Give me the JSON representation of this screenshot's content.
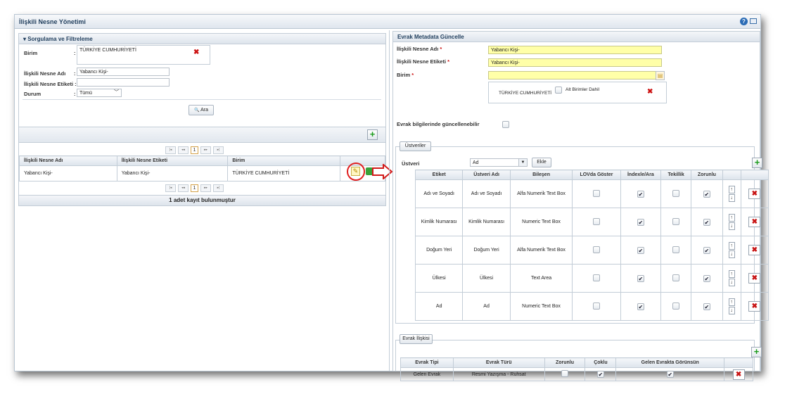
{
  "window": {
    "title": "İlişkili Nesne Yönetimi"
  },
  "filter": {
    "header": "Sorgulama ve Filtreleme",
    "birim_label": "Birim",
    "birim_value": "TÜRKİYE CUMHURİYETİ",
    "nesne_adi_label": "İlişkili Nesne Adı",
    "nesne_adi_value": "Yabancı Kişi-",
    "nesne_etiketi_label": "İlişkili Nesne Etiketi :",
    "durum_label": "Durum",
    "durum_value": "Tümü",
    "colon": ":",
    "search_button": "Ara"
  },
  "results": {
    "page": "1",
    "columns": [
      "İlişkili Nesne Adı",
      "İlişkili Nesne Etiketi",
      "Birim"
    ],
    "rows": [
      [
        "Yabancı Kişi-",
        "Yabancı Kişi-",
        "TÜRKİYE CUMHURİYETİ"
      ]
    ],
    "footer": "1 adet kayıt bulunmuştur"
  },
  "metadata": {
    "header": "Evrak Metadata Güncelle",
    "nesne_adi_label": "İlişkili Nesne Adı",
    "nesne_adi_value": "Yabancı Kişi-",
    "nesne_etiketi_label": "İlişkili Nesne Etiketi",
    "nesne_etiketi_value": "Yabancı Kişi-",
    "birim_label": "Birim",
    "required_mark": "*",
    "birim_value": "TÜRKİYE CUMHURİYETİ",
    "alt_birimler_label": "Alt Birimler Dahil",
    "guncellenebilir_label": "Evrak bilgilerinde güncellenebilir"
  },
  "ustveriler": {
    "legend": "Üstveriler",
    "select_label": "Üstveri",
    "select_value": "Ad",
    "add_button": "Ekle",
    "columns": [
      "Etiket",
      "Üstveri Adı",
      "Bileşen",
      "LOVda Göster",
      "İndexle/Ara",
      "Tekillik",
      "Zorunlu"
    ],
    "rows": [
      {
        "etiket": "Adı ve Soyadı",
        "ad": "Adı ve Soyadı",
        "bilesen": "Alfa Numerik Text Box",
        "lov": false,
        "index": true,
        "tekil": false,
        "zorunlu": true
      },
      {
        "etiket": "Kimlik Numarası",
        "ad": "Kimlik Numarası",
        "bilesen": "Numeric Text Box",
        "lov": false,
        "index": true,
        "tekil": false,
        "zorunlu": true
      },
      {
        "etiket": "Doğum Yeri",
        "ad": "Doğum Yeri",
        "bilesen": "Alfa Numerik Text Box",
        "lov": false,
        "index": true,
        "tekil": false,
        "zorunlu": true
      },
      {
        "etiket": "Ülkesi",
        "ad": "Ülkesi",
        "bilesen": "Text Area",
        "lov": false,
        "index": true,
        "tekil": false,
        "zorunlu": true
      },
      {
        "etiket": "Ad",
        "ad": "Ad",
        "bilesen": "Numeric Text Box",
        "lov": false,
        "index": true,
        "tekil": false,
        "zorunlu": true
      }
    ]
  },
  "evrak": {
    "legend": "Evrak İlişkisi",
    "columns": [
      "Evrak Tipi",
      "Evrak Türü",
      "Zorunlu",
      "Çoklu",
      "Gelen Evrakta Görünsün"
    ],
    "rows": [
      {
        "tip": "Gelen Evrak",
        "tur": "Resmi Yazışma - Ruhsat",
        "zorunlu": false,
        "coklu": true,
        "gorunsun": true
      }
    ]
  },
  "icons": {
    "check": "✔",
    "cross": "✖",
    "up": "↑",
    "down": "↓",
    "plus": "+",
    "edit": "✎",
    "search": "🔍",
    "pager_first": "|◂",
    "pager_prev": "◂◂",
    "pager_next": "▸▸",
    "pager_last": "▸|"
  },
  "colors": {
    "accent": "#1f3d5c",
    "required": "#cc1111",
    "highlight_circle": "#e02020",
    "field_yellow": "#ffffa8"
  }
}
